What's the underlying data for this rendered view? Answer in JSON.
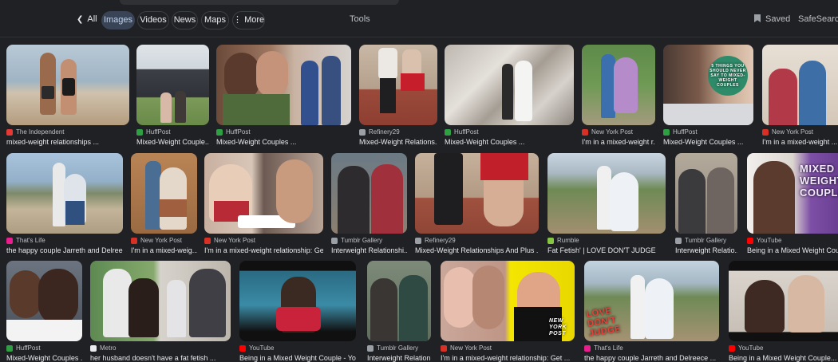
{
  "tabs": [
    {
      "label": "All",
      "active": false
    },
    {
      "label": "Images",
      "active": true
    },
    {
      "label": "Videos",
      "active": false
    },
    {
      "label": "News",
      "active": false
    },
    {
      "label": "Maps",
      "active": false
    },
    {
      "label": "More",
      "active": false
    }
  ],
  "tools_label": "Tools",
  "saved_label": "Saved",
  "safesearch_label": "SafeSearch",
  "rows": [
    [
      {
        "source": "The Independent",
        "title": "mixed-weight relationships ...",
        "fav": "#e53935"
      },
      {
        "source": "HuffPost",
        "title": "Mixed-Weight Couple...",
        "fav": "#2ea043"
      },
      {
        "source": "HuffPost",
        "title": "Mixed-Weight Couples ...",
        "fav": "#2ea043"
      },
      {
        "source": "Refinery29",
        "title": "Mixed-Weight Relations...",
        "fav": "#9aa0a6"
      },
      {
        "source": "HuffPost",
        "title": "Mixed-Weight Couples ...",
        "fav": "#2ea043"
      },
      {
        "source": "New York Post",
        "title": "I'm in a mixed-weight r...",
        "fav": "#d93025"
      },
      {
        "source": "HuffPost",
        "title": "Mixed-Weight Couples ...",
        "fav": "#2ea043"
      },
      {
        "source": "New York Post",
        "title": "I'm in a mixed-weight ...",
        "fav": "#d93025"
      }
    ],
    [
      {
        "source": "That's Life",
        "title": "the happy couple Jarreth and Delreec...",
        "fav": "#e91e8c"
      },
      {
        "source": "New York Post",
        "title": "I'm in a mixed-weig...",
        "fav": "#d93025"
      },
      {
        "source": "New York Post",
        "title": "I'm in a mixed-weight relationship: Get...",
        "fav": "#d93025"
      },
      {
        "source": "Tumblr Gallery",
        "title": "Interweight Relationshi...",
        "fav": "#9aa0a6"
      },
      {
        "source": "Refinery29",
        "title": "Mixed-Weight Relationships And Plus ...",
        "fav": "#9aa0a6"
      },
      {
        "source": "Rumble",
        "title": "Fat Fetish' | LOVE DON'T JUDGE",
        "fav": "#85c742"
      },
      {
        "source": "Tumblr Gallery",
        "title": "Interweight Relatio...",
        "fav": "#9aa0a6"
      },
      {
        "source": "YouTube",
        "title": "Being in a Mixed Weight Couple...",
        "fav": "#ff0000"
      }
    ],
    [
      {
        "source": "HuffPost",
        "title": "Mixed-Weight Couples ...",
        "fav": "#2ea043"
      },
      {
        "source": "Metro",
        "title": "her husband doesn't have a fat fetish ...",
        "fav": "#e8eaed"
      },
      {
        "source": "YouTube",
        "title": "Being in a Mixed Weight Couple - You...",
        "fav": "#ff0000"
      },
      {
        "source": "Tumblr Gallery",
        "title": "Interweight Relation...",
        "fav": "#9aa0a6"
      },
      {
        "source": "New York Post",
        "title": "I'm in a mixed-weight relationship: Get ...",
        "fav": "#d93025"
      },
      {
        "source": "That's Life",
        "title": "the happy couple Jarreth and Delreece ...",
        "fav": "#e91e8c"
      },
      {
        "source": "YouTube",
        "title": "Being in a Mixed Weight Couple...",
        "fav": "#ff0000"
      }
    ]
  ],
  "overlays": {
    "mixed_weight_couples": "MIXED WEIGHT COUPLE",
    "love_dont_judge": "LOVE DON'T JUDGE",
    "ny_post": "NEW YORK POST",
    "things_you_should_never_say": "5 THINGS YOU SHOULD NEVER SAY TO MIXED-WEIGHT COUPLES"
  }
}
